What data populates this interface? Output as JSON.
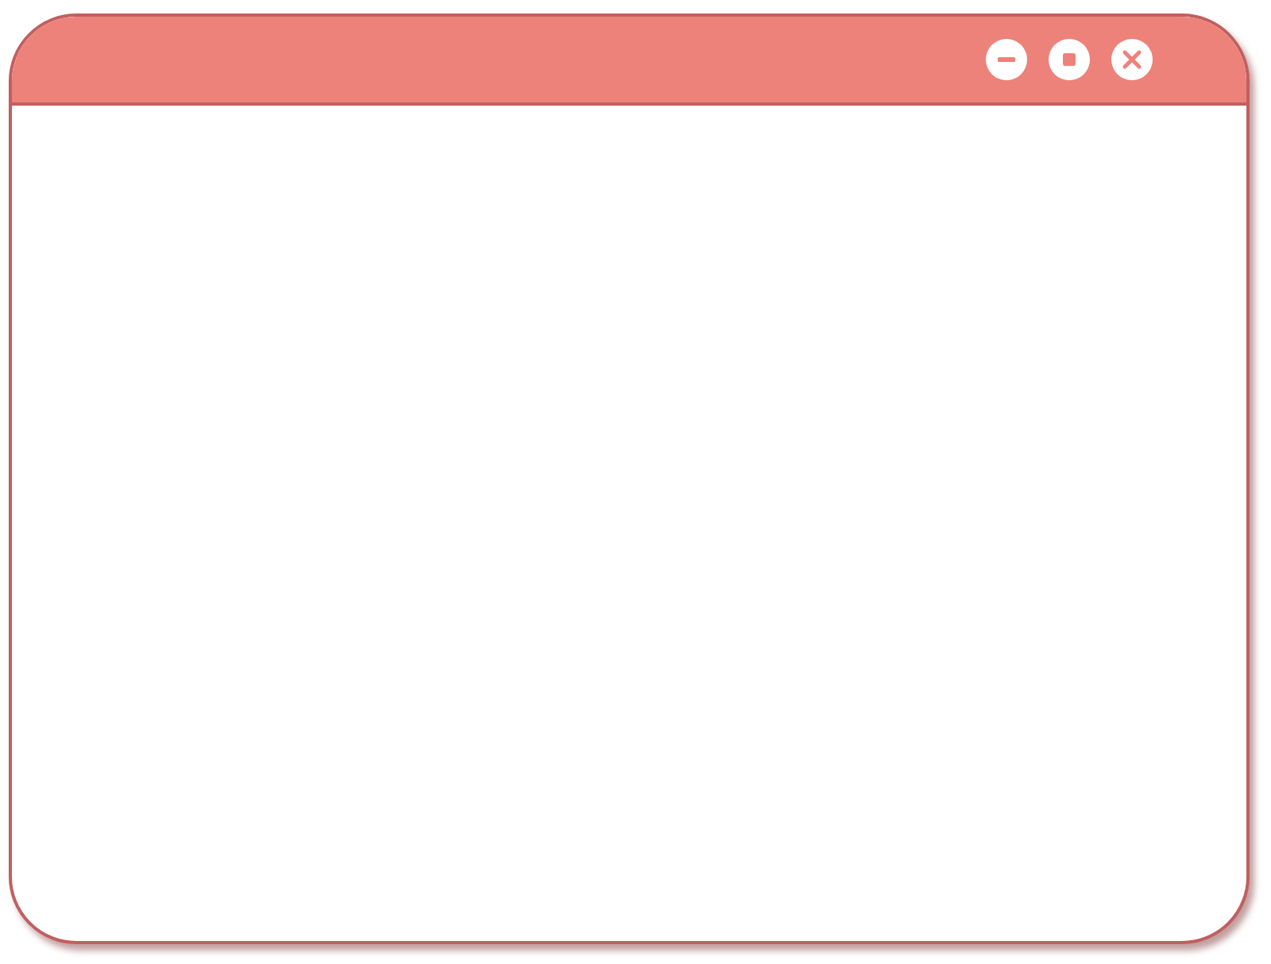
{
  "window": {
    "controls": [
      {
        "kind": "minimize"
      },
      {
        "kind": "maximize"
      },
      {
        "kind": "close"
      }
    ]
  }
}
